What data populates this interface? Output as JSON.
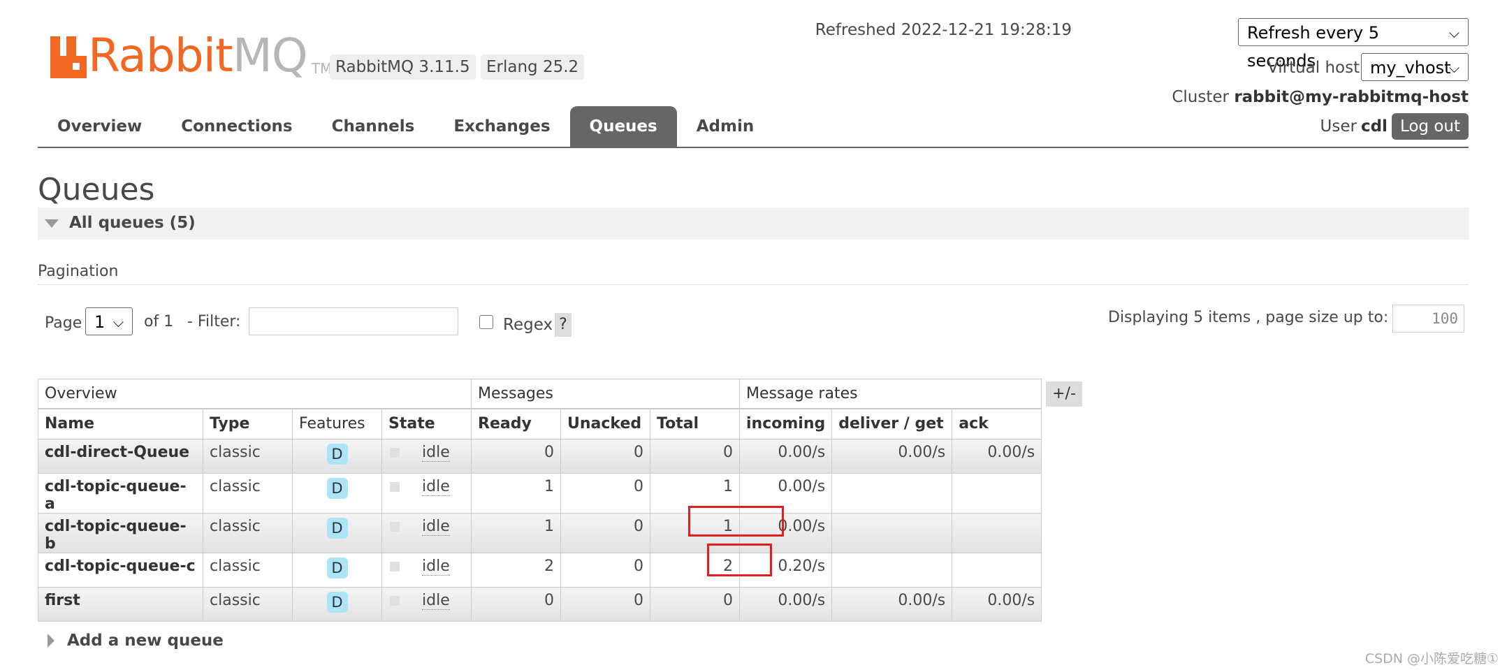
{
  "header": {
    "logo_rabbit": "Rabbit",
    "logo_mq": "MQ",
    "logo_tm": "TM",
    "rabbitmq_version": "RabbitMQ 3.11.5",
    "erlang_version": "Erlang 25.2",
    "refreshed_label": "Refreshed 2022-12-21 19:28:19",
    "refresh_select": "Refresh every 5 seconds",
    "vhost_label": "Virtual host",
    "vhost_select": "my_vhost",
    "cluster_label": "Cluster",
    "cluster_name": "rabbit@my-rabbitmq-host",
    "user_label": "User",
    "user_name": "cdl",
    "logout": "Log out"
  },
  "tabs": [
    {
      "label": "Overview"
    },
    {
      "label": "Connections"
    },
    {
      "label": "Channels"
    },
    {
      "label": "Exchanges"
    },
    {
      "label": "Queues",
      "active": true
    },
    {
      "label": "Admin"
    }
  ],
  "page": {
    "title": "Queues",
    "section": "All queues (5)",
    "pagination_label": "Pagination",
    "page_label": "Page",
    "page_value": "1",
    "of_label": "of 1",
    "filter_label": "- Filter:",
    "filter_value": "",
    "regex_label": "Regex",
    "help": "?",
    "display_text": "Displaying 5 items , page size up to:",
    "page_size": "100",
    "add_queue": "Add a new queue"
  },
  "table": {
    "groups": [
      "Overview",
      "Messages",
      "Message rates"
    ],
    "plus_minus": "+/-",
    "columns": [
      "Name",
      "Type",
      "Features",
      "State",
      "Ready",
      "Unacked",
      "Total",
      "incoming",
      "deliver / get",
      "ack"
    ],
    "rows": [
      {
        "name": "cdl-direct-Queue",
        "type": "classic",
        "feature": "D",
        "state": "idle",
        "ready": "0",
        "unacked": "0",
        "total": "0",
        "incoming": "0.00/s",
        "deliver_get": "0.00/s",
        "ack": "0.00/s"
      },
      {
        "name": "cdl-topic-queue-a",
        "type": "classic",
        "feature": "D",
        "state": "idle",
        "ready": "1",
        "unacked": "0",
        "total": "1",
        "incoming": "0.00/s",
        "deliver_get": "",
        "ack": ""
      },
      {
        "name": "cdl-topic-queue-b",
        "type": "classic",
        "feature": "D",
        "state": "idle",
        "ready": "1",
        "unacked": "0",
        "total": "1",
        "incoming": "0.00/s",
        "deliver_get": "",
        "ack": ""
      },
      {
        "name": "cdl-topic-queue-c",
        "type": "classic",
        "feature": "D",
        "state": "idle",
        "ready": "2",
        "unacked": "0",
        "total": "2",
        "incoming": "0.20/s",
        "deliver_get": "",
        "ack": ""
      },
      {
        "name": "first",
        "type": "classic",
        "feature": "D",
        "state": "idle",
        "ready": "0",
        "unacked": "0",
        "total": "0",
        "incoming": "0.00/s",
        "deliver_get": "0.00/s",
        "ack": "0.00/s"
      }
    ]
  },
  "watermark": "CSDN @小陈爱吃糖①",
  "colors": {
    "brand": "#f26722",
    "tab_active": "#666666",
    "highlight": "#e02020",
    "feature_badge": "#aee4f7"
  }
}
